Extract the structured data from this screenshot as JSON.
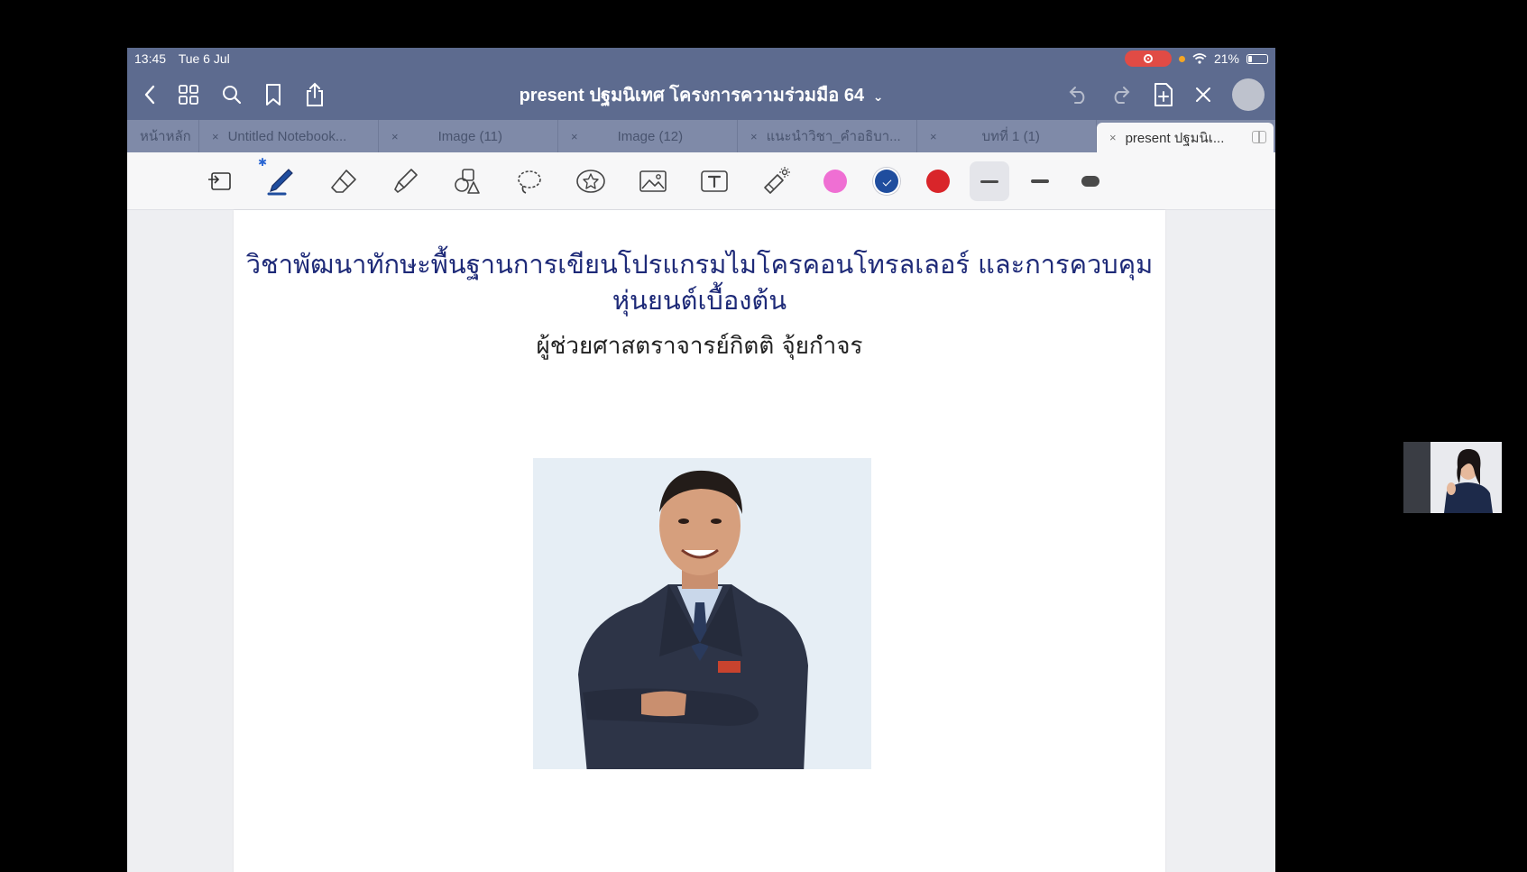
{
  "status_bar": {
    "time": "13:45",
    "date": "Tue 6 Jul",
    "battery": "21%"
  },
  "nav": {
    "document_title": "present ปฐมนิเทศ โครงการความร่วมมือ 64",
    "title_chevron": "⌄"
  },
  "tabs": [
    {
      "label": "หน้าหลัก",
      "active": false,
      "close": ""
    },
    {
      "label": "Untitled Notebook...",
      "active": false,
      "close": "×"
    },
    {
      "label": "Image (11)",
      "active": false,
      "close": "×"
    },
    {
      "label": "Image (12)",
      "active": false,
      "close": "×"
    },
    {
      "label": "แนะนำวิชา_คำอธิบา...",
      "active": false,
      "close": "×"
    },
    {
      "label": "บทที่ 1 (1)",
      "active": false,
      "close": "×"
    },
    {
      "label": "present ปฐมนิเ...",
      "active": true,
      "close": "×"
    }
  ],
  "toolbar": {
    "tools": [
      "page-tool-icon",
      "pen-icon",
      "eraser-icon",
      "highlighter-icon",
      "shapes-icon",
      "lasso-icon",
      "sticker-icon",
      "image-icon",
      "text-icon",
      "laser-pointer-icon"
    ],
    "colors": [
      "#ef6fd3",
      "#1f4d9e",
      "#d9252a"
    ],
    "selected_color": "#1f4d9e",
    "strokes": [
      "thin",
      "medium",
      "thick"
    ],
    "selected_stroke": "thin"
  },
  "document": {
    "title_line1": "วิชาพัฒนาทักษะพื้นฐานการเขียนโปรแกรมไมโครคอนโทรลเลอร์ และการควบคุม",
    "title_line2": "หุ่นยนต์เบื้องต้น",
    "author": "ผู้ช่วยศาสตราจารย์กิตติ จุ้ยกำจร"
  }
}
